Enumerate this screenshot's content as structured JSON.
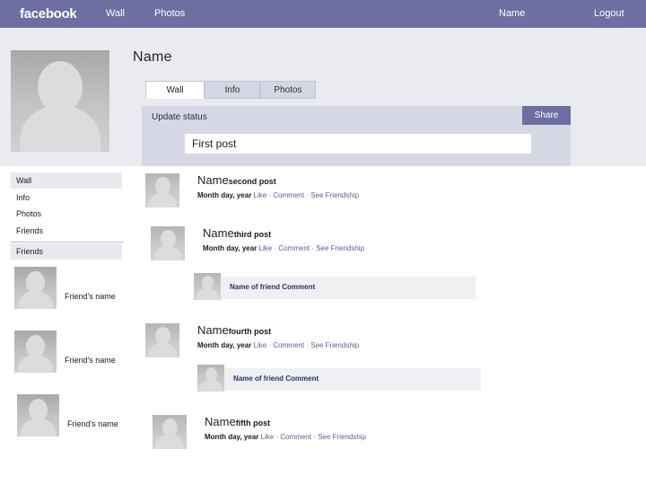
{
  "topbar": {
    "brand": "facebook",
    "links": [
      {
        "label": "Wall"
      },
      {
        "label": "Photos"
      },
      {
        "label": "Name"
      },
      {
        "label": "Logout"
      }
    ]
  },
  "profile": {
    "name": "Name",
    "photo_alt": "profile-photo-placeholder",
    "tabs": [
      {
        "label": "Wall",
        "active": true
      },
      {
        "label": "Info",
        "active": false
      },
      {
        "label": "Photos",
        "active": false
      }
    ]
  },
  "composer": {
    "label": "Update status",
    "share_label": "Share",
    "input_value": "First post",
    "input_placeholder": ""
  },
  "sidebar": {
    "items": [
      {
        "label": "Wall",
        "selected": true
      },
      {
        "label": "Info",
        "selected": false
      },
      {
        "label": "Photos",
        "selected": false
      },
      {
        "label": "Friends",
        "selected": false
      }
    ],
    "section_header": "Friends",
    "friends": [
      {
        "name": "Friend's name"
      },
      {
        "name": "Friend's name"
      },
      {
        "name": "Friend's name"
      }
    ]
  },
  "feed": {
    "meta": {
      "date": "Month day, year",
      "like": "Like",
      "comment": "Comment",
      "see_friendship": "See Friendship",
      "separator": "·"
    },
    "posts": [
      {
        "author": "Name",
        "kicker": "second post"
      },
      {
        "author": "Name",
        "kicker": "third post"
      },
      {
        "author": "Name",
        "kicker": "fourth post"
      },
      {
        "author": "Name",
        "kicker": "fifth post"
      }
    ],
    "comments": [
      {
        "text": "Name of friend Comment"
      },
      {
        "text": "Name of friend Comment"
      }
    ]
  },
  "colors": {
    "nav_purple": "#6d6fa2",
    "header_band": "#eaebf0",
    "composer_bg": "#d5d8e4",
    "tab_inactive": "#d3d6e3",
    "link_blue": "#5a5f96",
    "comment_bg": "#eef0f4"
  }
}
